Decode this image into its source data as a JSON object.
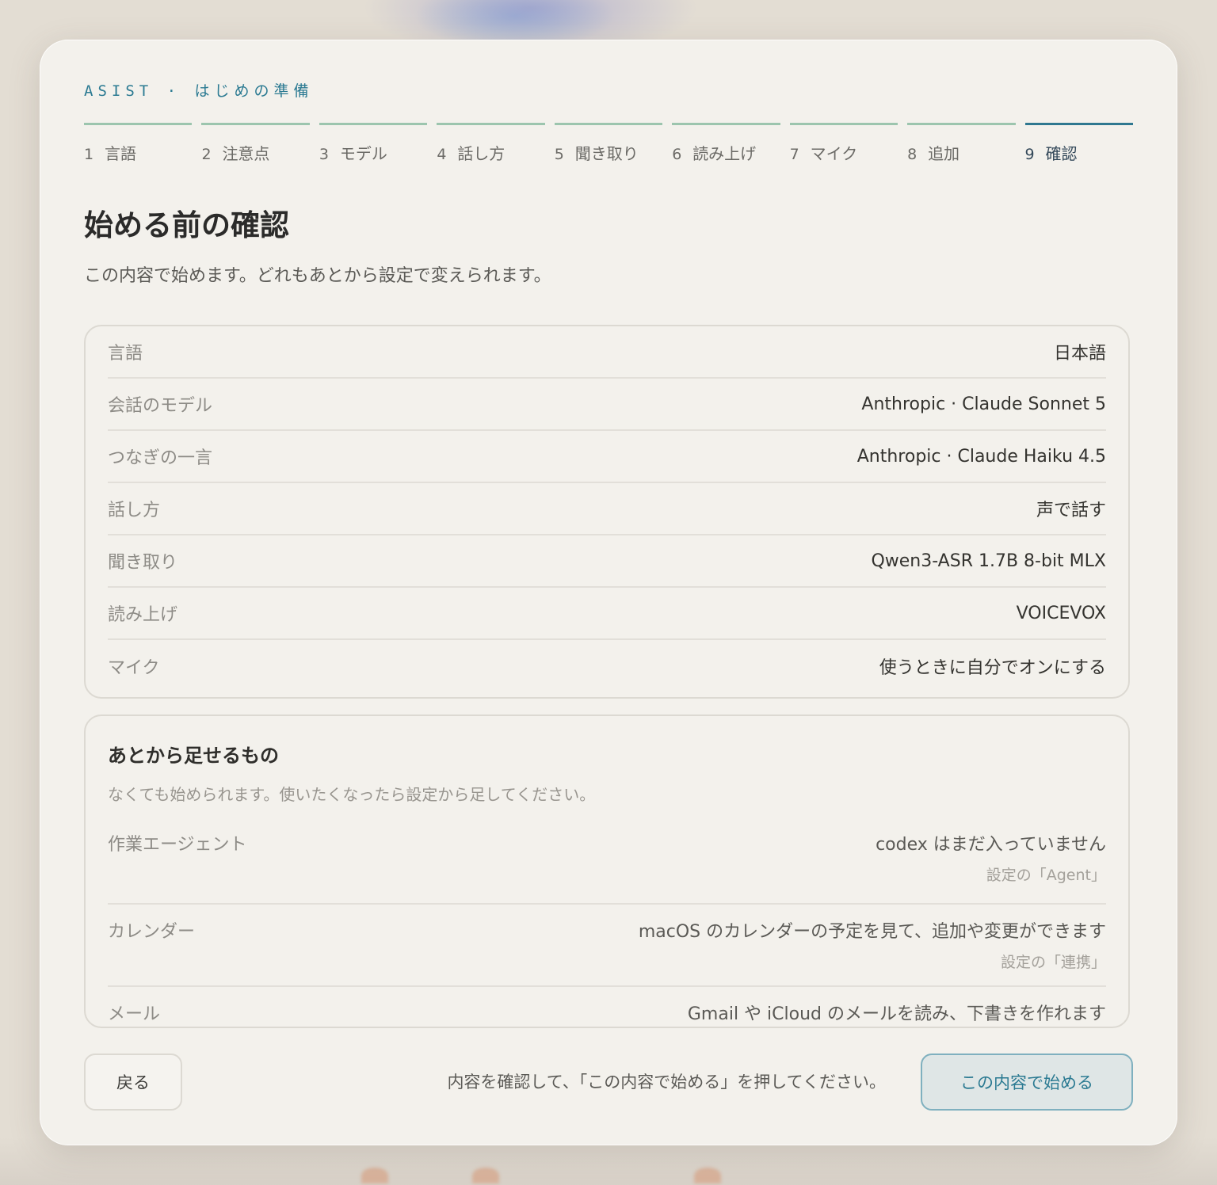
{
  "header": {
    "eyebrow": "ASIST · はじめの準備"
  },
  "steps": [
    {
      "num": "1",
      "label": "言語"
    },
    {
      "num": "2",
      "label": "注意点"
    },
    {
      "num": "3",
      "label": "モデル"
    },
    {
      "num": "4",
      "label": "話し方"
    },
    {
      "num": "5",
      "label": "聞き取り"
    },
    {
      "num": "6",
      "label": "読み上げ"
    },
    {
      "num": "7",
      "label": "マイク"
    },
    {
      "num": "8",
      "label": "追加"
    },
    {
      "num": "9",
      "label": "確認"
    }
  ],
  "active_step": "9",
  "page": {
    "title": "始める前の確認",
    "subtitle": "この内容で始めます。どれもあとから設定で変えられます。"
  },
  "summary": [
    {
      "key": "言語",
      "value": "日本語"
    },
    {
      "key": "会話のモデル",
      "value": "Anthropic · Claude Sonnet 5"
    },
    {
      "key": "つなぎの一言",
      "value": "Anthropic · Claude Haiku 4.5"
    },
    {
      "key": "話し方",
      "value": "声で話す"
    },
    {
      "key": "聞き取り",
      "value": "Qwen3-ASR 1.7B 8-bit MLX"
    },
    {
      "key": "読み上げ",
      "value": "VOICEVOX"
    },
    {
      "key": "マイク",
      "value": "使うときに自分でオンにする"
    }
  ],
  "extras": {
    "title": "あとから足せるもの",
    "hint": "なくても始められます。使いたくなったら設定から足してください。",
    "items": [
      {
        "key": "作業エージェント",
        "value": "codex はまだ入っていません",
        "where": "設定の「Agent」"
      },
      {
        "key": "カレンダー",
        "value": "macOS のカレンダーの予定を見て、追加や変更ができます",
        "where": "設定の「連携」"
      },
      {
        "key": "メール",
        "value": "Gmail や iCloud のメールを読み、下書きを作れます",
        "where": ""
      }
    ]
  },
  "footer": {
    "back_label": "戻る",
    "note": "内容を確認して、「この内容で始める」を押してください。",
    "start_label": "この内容で始める"
  },
  "colors": {
    "accent": "#2b7a92",
    "step_done": "#9cc5ae",
    "step_active": "#2f7890"
  }
}
